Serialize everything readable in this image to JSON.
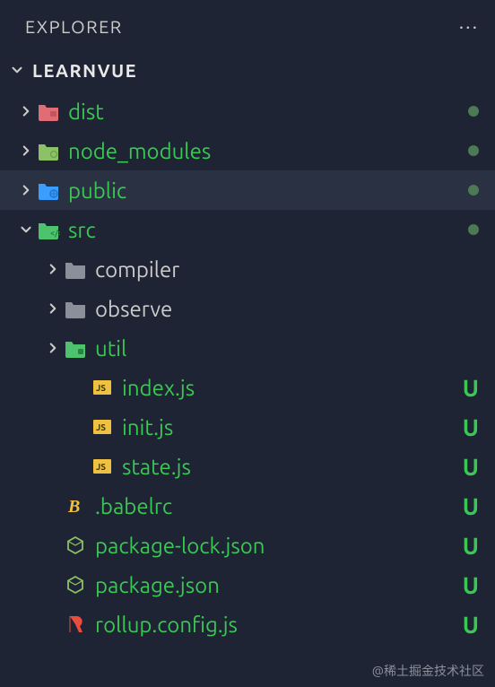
{
  "header": {
    "title": "EXPLORER"
  },
  "project": {
    "name": "LEARNVUE"
  },
  "tree": [
    {
      "id": "dist",
      "label": "dist",
      "type": "folder",
      "icon": "folder-red",
      "indent": 1,
      "expanded": false,
      "status": "dot",
      "hasChevron": true,
      "green": true
    },
    {
      "id": "node_modules",
      "label": "node_modules",
      "type": "folder",
      "icon": "folder-green",
      "indent": 1,
      "expanded": false,
      "status": "dot",
      "hasChevron": true,
      "green": true
    },
    {
      "id": "public",
      "label": "public",
      "type": "folder",
      "icon": "folder-blue",
      "indent": 1,
      "expanded": false,
      "status": "dot",
      "hasChevron": true,
      "selected": true,
      "green": true
    },
    {
      "id": "src",
      "label": "src",
      "type": "folder",
      "icon": "folder-src",
      "indent": 1,
      "expanded": true,
      "status": "dot",
      "hasChevron": true,
      "green": true
    },
    {
      "id": "compiler",
      "label": "compiler",
      "type": "folder",
      "icon": "folder-gray",
      "indent": 2,
      "expanded": false,
      "hasChevron": true,
      "green": false
    },
    {
      "id": "observe",
      "label": "observe",
      "type": "folder",
      "icon": "folder-gray",
      "indent": 2,
      "expanded": false,
      "hasChevron": true,
      "green": false
    },
    {
      "id": "util",
      "label": "util",
      "type": "folder",
      "icon": "folder-util",
      "indent": 2,
      "expanded": false,
      "hasChevron": true,
      "green": true
    },
    {
      "id": "index.js",
      "label": "index.js",
      "type": "file",
      "icon": "js",
      "indent": 3,
      "status": "U",
      "green": true
    },
    {
      "id": "init.js",
      "label": "init.js",
      "type": "file",
      "icon": "js",
      "indent": 3,
      "status": "U",
      "green": true
    },
    {
      "id": "state.js",
      "label": "state.js",
      "type": "file",
      "icon": "js",
      "indent": 3,
      "status": "U",
      "green": true
    },
    {
      "id": ".babelrc",
      "label": ".babelrc",
      "type": "file",
      "icon": "babel",
      "indent": 2,
      "status": "U",
      "green": true
    },
    {
      "id": "package-lock.json",
      "label": "package-lock.json",
      "type": "file",
      "icon": "node",
      "indent": 2,
      "status": "U",
      "green": true
    },
    {
      "id": "package.json",
      "label": "package.json",
      "type": "file",
      "icon": "node",
      "indent": 2,
      "status": "U",
      "green": true
    },
    {
      "id": "rollup.config.js",
      "label": "rollup.config.js",
      "type": "file",
      "icon": "rollup",
      "indent": 2,
      "status": "U",
      "green": true
    }
  ],
  "watermark": "@稀土掘金技术社区"
}
